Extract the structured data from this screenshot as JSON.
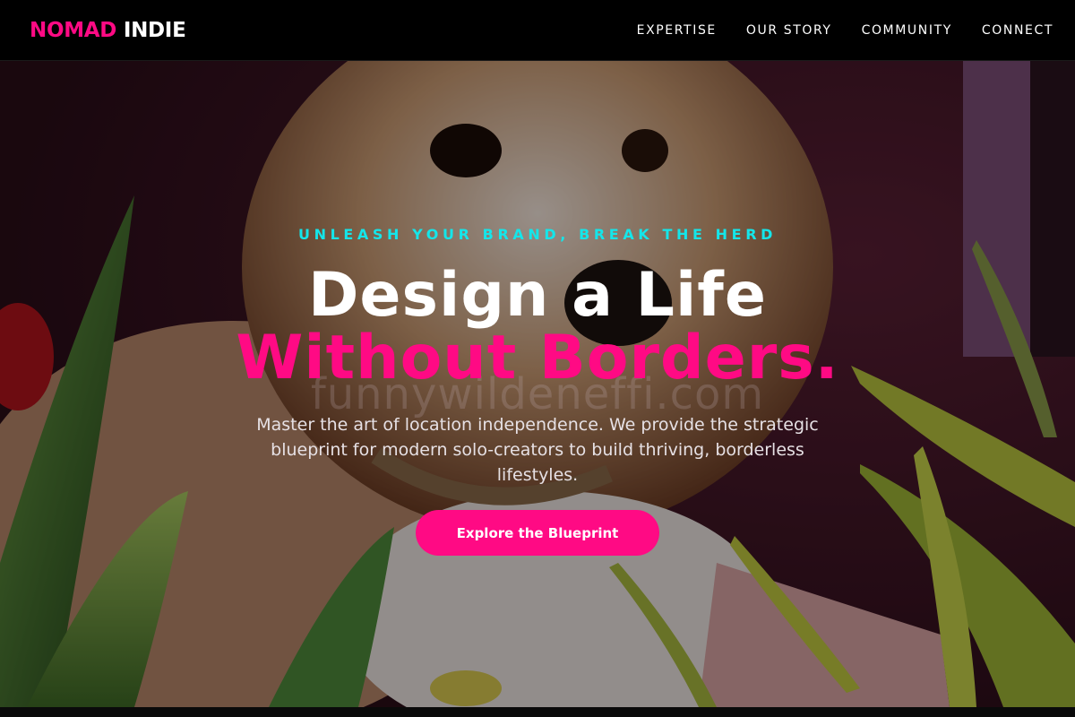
{
  "brand": {
    "part1": "NOMAD",
    "part2": "INDIE"
  },
  "nav": {
    "items": [
      {
        "label": "EXPERTISE"
      },
      {
        "label": "OUR STORY"
      },
      {
        "label": "COMMUNITY"
      },
      {
        "label": "CONNECT"
      }
    ]
  },
  "hero": {
    "kicker": "UNLEASH YOUR BRAND, BREAK THE HERD",
    "headline_line1": "Design a Life",
    "headline_line2": "Without Borders.",
    "watermark": "funnywildeneffi.com",
    "description": "Master the art of location independence. We provide the strategic blueprint for modern solo-creators to build thriving, borderless lifestyles.",
    "cta_label": "Explore the Blueprint"
  },
  "colors": {
    "accent": "#ff0a84",
    "kicker": "#14e6ea",
    "nav_bg": "#000000"
  }
}
